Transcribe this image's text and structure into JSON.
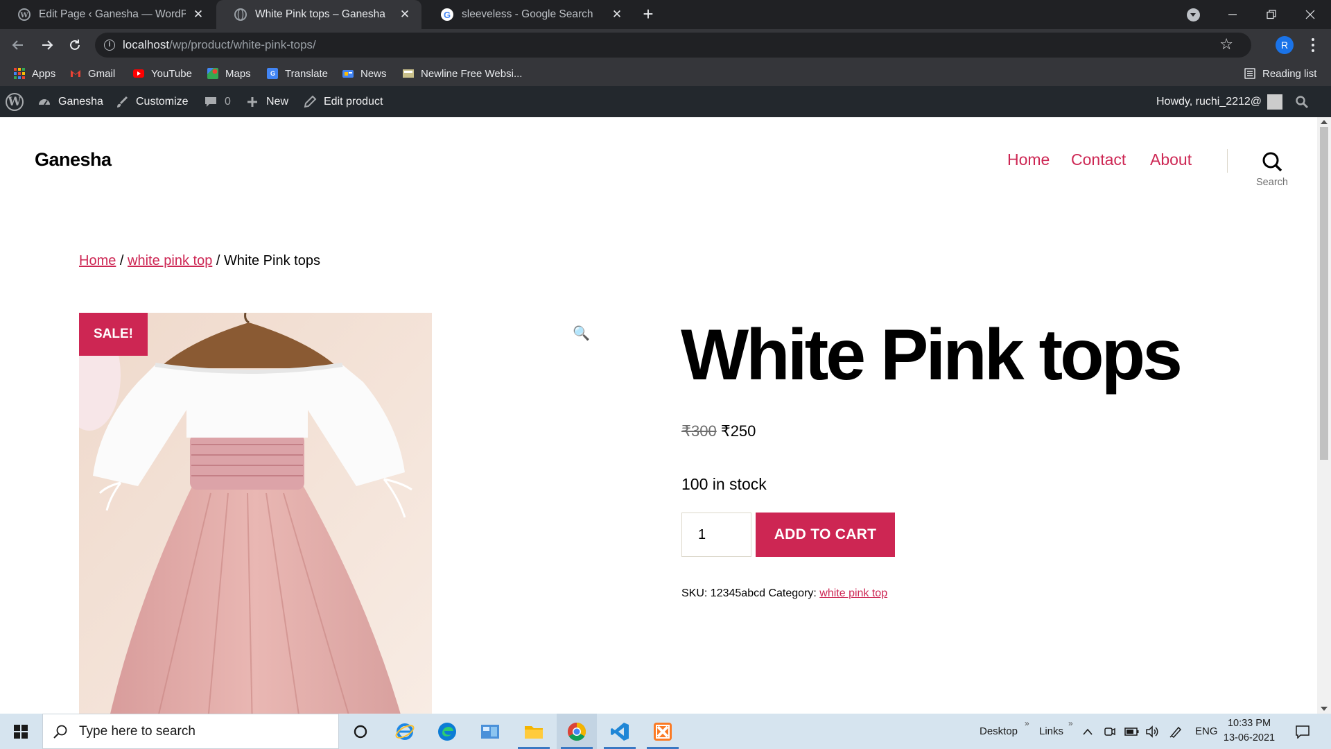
{
  "browser": {
    "tabs": [
      {
        "title": "Edit Page ‹ Ganesha — WordPress",
        "active": false
      },
      {
        "title": "White Pink tops – Ganesha",
        "active": true
      },
      {
        "title": "sleeveless - Google Search",
        "active": false
      }
    ],
    "url_host": "localhost",
    "url_path": "/wp/product/white-pink-tops/",
    "profile_initial": "R"
  },
  "bookmarks": {
    "items": [
      "Apps",
      "Gmail",
      "YouTube",
      "Maps",
      "Translate",
      "News",
      "Newline Free Websi..."
    ],
    "reading_list": "Reading list"
  },
  "admin_bar": {
    "site": "Ganesha",
    "customize": "Customize",
    "comments_count": "0",
    "new": "New",
    "edit_product": "Edit product",
    "howdy": "Howdy, ruchi_2212@"
  },
  "site": {
    "title": "Ganesha",
    "nav": [
      "Home",
      "Contact",
      "About"
    ],
    "search_label": "Search"
  },
  "breadcrumb": {
    "home": "Home",
    "sep": " / ",
    "category": "white pink top",
    "current": "White Pink tops"
  },
  "product": {
    "sale_badge": "SALE!",
    "zoom_icon": "🔍",
    "title": "White Pink tops",
    "regular_price": "₹300",
    "sale_price": "₹250",
    "stock": "100 in stock",
    "quantity": "1",
    "add_to_cart": "ADD TO CART",
    "sku_label": "SKU:",
    "sku": "12345abcd",
    "category_label": "Category:",
    "category": "white pink top"
  },
  "taskbar": {
    "search_placeholder": "Type here to search",
    "desktop": "Desktop",
    "links": "Links",
    "language": "ENG",
    "time": "10:33 PM",
    "date": "13-06-2021"
  },
  "colors": {
    "accent": "#cd2653",
    "chrome_dark": "#202124",
    "chrome_toolbar": "#35363a",
    "admin_bar": "#23282d",
    "taskbar": "#d6e4ef"
  }
}
